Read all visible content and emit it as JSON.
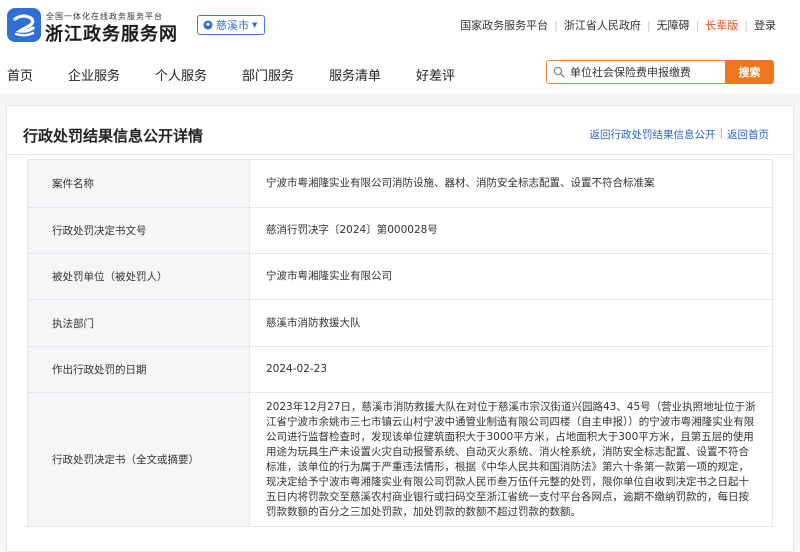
{
  "header": {
    "brand_small": "全国一体化在线政务服务平台",
    "brand_name": "浙江政务服务网",
    "region": "慈溪市",
    "links": [
      {
        "label": "国家政务服务平台"
      },
      {
        "label": "浙江省人民政府"
      },
      {
        "label": "无障碍"
      },
      {
        "label": "长辈版"
      },
      {
        "label": "登录"
      }
    ]
  },
  "nav": {
    "items": [
      {
        "label": "首页"
      },
      {
        "label": "企业服务"
      },
      {
        "label": "个人服务"
      },
      {
        "label": "部门服务"
      },
      {
        "label": "服务清单"
      },
      {
        "label": "好差评"
      }
    ],
    "search_value": "单位社会保险费申报缴费",
    "search_button": "搜索"
  },
  "page": {
    "title": "行政处罚结果信息公开详情",
    "back_list": "返回行政处罚结果信息公开",
    "back_home": "返回首页"
  },
  "details": [
    {
      "key": "案件名称",
      "value": "宁波市粤湘隆实业有限公司消防设施、器材、消防安全标志配置、设置不符合标准案"
    },
    {
      "key": "行政处罚决定书文号",
      "value": "慈消行罚决字〔2024〕第000028号"
    },
    {
      "key": "被处罚单位（被处罚人）",
      "value": "宁波市粤湘隆实业有限公司"
    },
    {
      "key": "执法部门",
      "value": "慈溪市消防救援大队"
    },
    {
      "key": "作出行政处罚的日期",
      "value": "2024-02-23"
    },
    {
      "key": "行政处罚决定书（全文或摘要）",
      "value": "2023年12月27日，慈溪市消防救援大队在对位于慈溪市宗汉街道兴园路43、45号（营业执照地址位于浙江省宁波市余姚市三七市镇云山村宁波中通管业制造有限公司四楼（自主申报））的宁波市粤湘隆实业有限公司进行监督检查时，发现该单位建筑面积大于3000平方米，占地面积大于300平方米，且第五层的使用用途为玩具生产未设置火灾自动报警系统、自动灭火系统、消火栓系统，消防安全标志配置、设置不符合标准，该单位的行为属于严重违法情形，根据《中华人民共和国消防法》第六十条第一款第一项的规定，现决定给予宁波市粤湘隆实业有限公司罚款人民币叁万伍仟元整的处罚，限你单位自收到决定书之日起十五日内将罚款交至慈溪农村商业银行或扫码交至浙江省统一支付平台各网点，逾期不缴纳罚款的，每日按罚款数额的百分之三加处罚款，加处罚款的数额不超过罚款的数额。"
    }
  ],
  "colors": {
    "accent": "#f0751f",
    "link": "#2b66c9",
    "elder": "#e8501f"
  }
}
